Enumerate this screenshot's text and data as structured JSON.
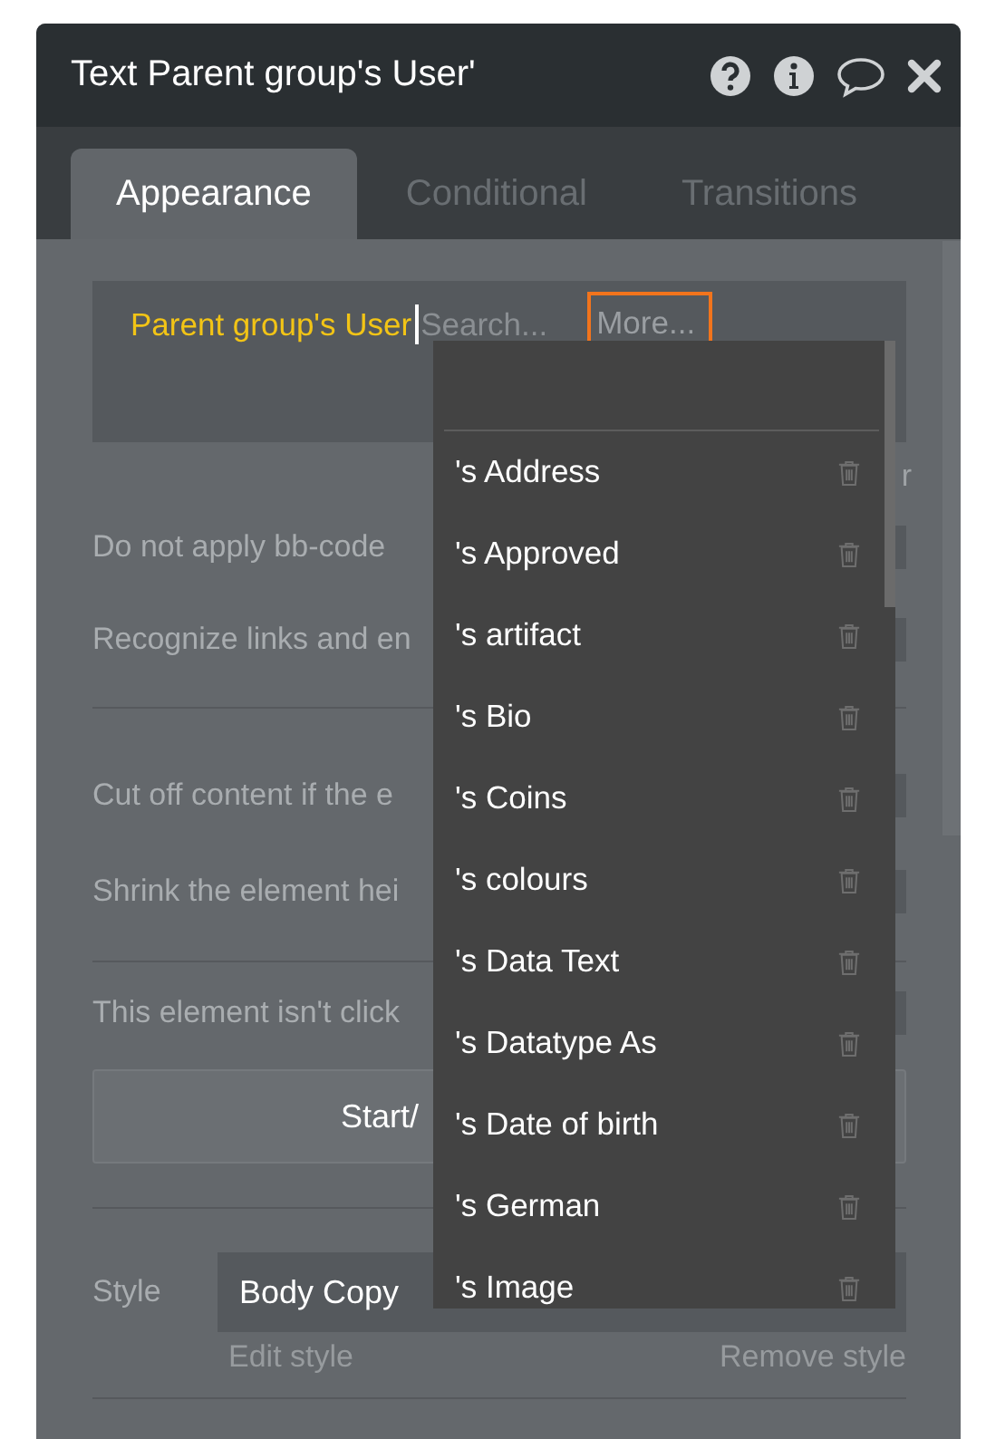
{
  "window": {
    "title": "Text Parent group's User'"
  },
  "tabs": [
    {
      "label": "Appearance",
      "selected": true
    },
    {
      "label": "Conditional",
      "selected": false
    },
    {
      "label": "Transitions",
      "selected": false
    }
  ],
  "expression": {
    "value": "Parent group's User",
    "placeholder": "Search...",
    "more": "More..."
  },
  "groups": [
    {
      "rows": [
        {
          "kind": "note",
          "label": "r"
        },
        {
          "kind": "checkbox",
          "label": "Do not apply bb-code",
          "checked": false
        },
        {
          "kind": "checkbox",
          "label": "Recognize links and en",
          "checked": false
        }
      ]
    },
    {
      "rows": [
        {
          "kind": "checkbox",
          "label": "Cut off content if the e",
          "checked": false
        },
        {
          "kind": "checkbox",
          "label": "Shrink the element hei",
          "checked": false
        }
      ]
    },
    {
      "rows": [
        {
          "kind": "checkbox",
          "label": "This element isn't click",
          "checked": false
        },
        {
          "kind": "button",
          "label": "Start/"
        }
      ]
    }
  ],
  "style": {
    "label": "Style",
    "value": "Body Copy",
    "edit": "Edit style",
    "remove": "Remove style"
  },
  "dropdown": {
    "items": [
      "'s Address",
      "'s Approved",
      "'s artifact",
      "'s Bio",
      "'s Coins",
      "'s colours",
      "'s Data Text",
      "'s Datatype As",
      "'s Date of birth",
      "'s German",
      "'s Image"
    ]
  }
}
